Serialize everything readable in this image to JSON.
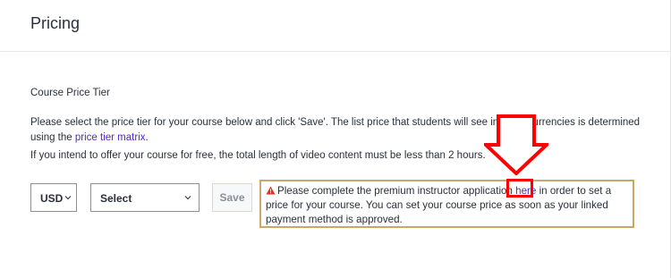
{
  "page": {
    "title": "Pricing"
  },
  "section": {
    "label": "Course Price Tier",
    "description_before": "Please select the price tier for your course below and click 'Save'. The list price that students will see in other currencies is determined using the ",
    "matrix_link": "price tier matrix",
    "description_after": ".",
    "free_note": "If you intend to offer your course for free, the total length of video content must be less than 2 hours."
  },
  "form": {
    "currency_value": "USD",
    "tier_value": "Select",
    "save_label": "Save"
  },
  "notice": {
    "text_before": "Please complete the premium instructor application ",
    "link": "here",
    "text_after": " in order to set a price for your course. You can set your course price as soon as your linked payment method is approved."
  },
  "colors": {
    "link": "#5624d0",
    "warning": "#e0331e",
    "notice_border": "#c9a96b",
    "annotation": "#ff0000"
  },
  "icons": {
    "currency_chevron": "chevron-down-icon",
    "tier_chevron": "chevron-down-icon",
    "warning": "warning-triangle-icon",
    "annotation": "down-arrow-icon"
  }
}
